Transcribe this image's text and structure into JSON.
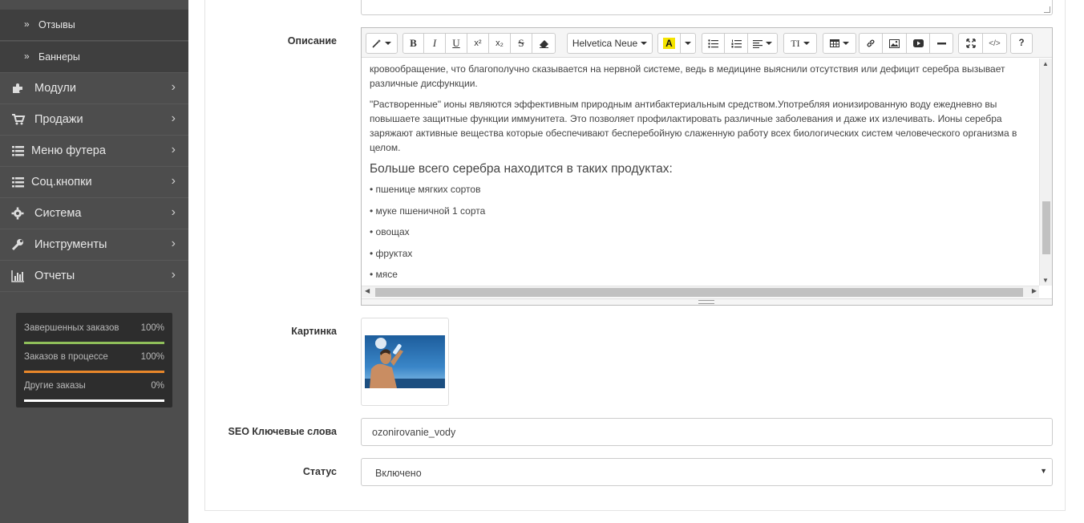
{
  "sidebar": {
    "sub_items": [
      {
        "label": "Отзывы"
      },
      {
        "label": "Баннеры"
      }
    ],
    "items": [
      {
        "label": "Модули",
        "icon": "puzzle-icon"
      },
      {
        "label": "Продажи",
        "icon": "cart-icon"
      },
      {
        "label": "Меню футера",
        "icon": "list-icon"
      },
      {
        "label": "Соц.кнопки",
        "icon": "list-icon"
      },
      {
        "label": "Система",
        "icon": "gear-icon"
      },
      {
        "label": "Инструменты",
        "icon": "wrench-icon"
      },
      {
        "label": "Отчеты",
        "icon": "bar-chart-icon"
      }
    ],
    "stats": [
      {
        "label": "Завершенных заказов",
        "percent": "100%",
        "fill": 1.0,
        "color": "#8fbf5a"
      },
      {
        "label": "Заказов в процессе",
        "percent": "100%",
        "fill": 1.0,
        "color": "#e8872a"
      },
      {
        "label": "Другие заказы",
        "percent": "0%",
        "fill": 1.0,
        "color": "#ffffff"
      }
    ]
  },
  "form": {
    "description_label": "Описание",
    "image_label": "Картинка",
    "seo_label": "SEO Ключевые слова",
    "seo_value": "ozonirovanie_vody",
    "status_label": "Статус",
    "status_value": "Включено"
  },
  "editor": {
    "font_name": "Helvetica Neue",
    "help_label": "?",
    "paragraph1": "кровообращение, что благополучно сказывается на нервной системе, ведь в медицине выяснили отсутствия или дефицит серебра вызывает различные дисфункции.",
    "paragraph2": "\"Растворенные\" ионы являются эффективным природным антибактериальным средством.Употребляя ионизированную воду ежедневно вы повышаете защитные функции иммунитета. Это позволяет профилактировать различные заболевания и даже их излечивать. Ионы серебра заряжают активные вещества которые обеспечивают бесперебойную слаженную работу всех биологических систем человеческого организма в целом.",
    "heading": "Больше всего серебра находится в таких продуктах:",
    "list": [
      "• пшенице мягких сортов",
      "• муке пшеничной 1 сорта",
      "• овощах",
      "• фруктах",
      "• мясе"
    ]
  },
  "colors": {
    "sidebar_bg": "#4d4d4d",
    "highlight_yellow": "#f5e400"
  }
}
